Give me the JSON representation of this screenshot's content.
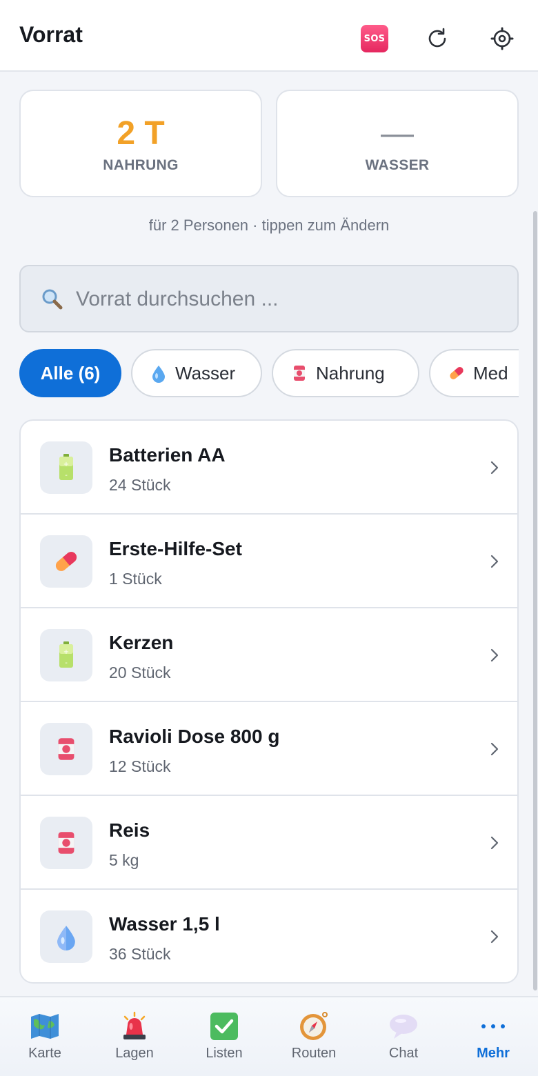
{
  "header": {
    "title": "Vorrat",
    "sos_label": "SOS",
    "icons": [
      "sos-icon",
      "refresh-icon",
      "gear-icon"
    ]
  },
  "stats": {
    "food": {
      "value": "2 T",
      "label": "NAHRUNG",
      "color": "#f2a127"
    },
    "water": {
      "value": "—",
      "label": "WASSER"
    }
  },
  "persons_hint": "für 2 Personen · tippen zum Ändern",
  "search": {
    "placeholder": "Vorrat durchsuchen ...",
    "value": ""
  },
  "filters": [
    {
      "label": "Alle (6)",
      "active": true
    },
    {
      "label": "Wasser",
      "icon": "water-drop-icon"
    },
    {
      "label": "Nahrung",
      "icon": "can-icon"
    },
    {
      "label": "Med",
      "icon": "pill-icon"
    }
  ],
  "items": [
    {
      "name": "Batterien AA",
      "qty": "24 Stück",
      "icon": "battery-icon"
    },
    {
      "name": "Erste-Hilfe-Set",
      "qty": "1 Stück",
      "icon": "pill-icon"
    },
    {
      "name": "Kerzen",
      "qty": "20 Stück",
      "icon": "battery-icon"
    },
    {
      "name": "Ravioli Dose 800 g",
      "qty": "12 Stück",
      "icon": "can-icon"
    },
    {
      "name": "Reis",
      "qty": "5 kg",
      "icon": "can-icon"
    },
    {
      "name": "Wasser 1,5 l",
      "qty": "36 Stück",
      "icon": "water-drop-icon"
    }
  ],
  "nav": [
    {
      "label": "Karte",
      "icon": "map-icon"
    },
    {
      "label": "Lagen",
      "icon": "alarm-light-icon"
    },
    {
      "label": "Listen",
      "icon": "checkbox-icon"
    },
    {
      "label": "Routen",
      "icon": "compass-icon"
    },
    {
      "label": "Chat",
      "icon": "speech-bubble-icon"
    },
    {
      "label": "Mehr",
      "icon": "more-dots-icon",
      "active": true
    }
  ],
  "colors": {
    "accent": "#0f6fd8",
    "orange": "#f2a127",
    "sos": "#e5275f"
  }
}
